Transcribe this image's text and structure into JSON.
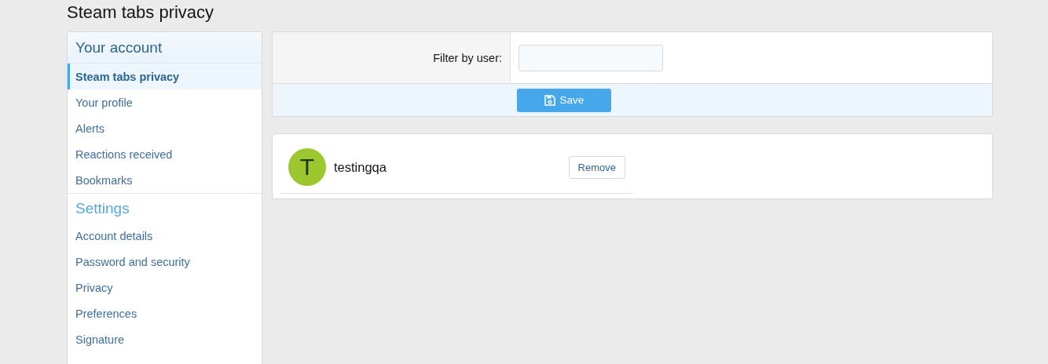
{
  "page_title": "Steam tabs privacy",
  "sidebar": {
    "sections": [
      {
        "title": "Your account",
        "items": [
          {
            "label": "Steam tabs privacy",
            "selected": true
          },
          {
            "label": "Your profile",
            "selected": false
          },
          {
            "label": "Alerts",
            "selected": false
          },
          {
            "label": "Reactions received",
            "selected": false
          },
          {
            "label": "Bookmarks",
            "selected": false
          }
        ]
      },
      {
        "title": "Settings",
        "items": [
          {
            "label": "Account details",
            "selected": false
          },
          {
            "label": "Password and security",
            "selected": false
          },
          {
            "label": "Privacy",
            "selected": false
          },
          {
            "label": "Preferences",
            "selected": false
          },
          {
            "label": "Signature",
            "selected": false
          }
        ]
      }
    ]
  },
  "filter": {
    "label": "Filter by user:"
  },
  "save_button": {
    "label": "Save"
  },
  "users": [
    {
      "initial": "T",
      "name": "testingqa",
      "color": "#9dc72e",
      "action": "Remove"
    }
  ]
}
